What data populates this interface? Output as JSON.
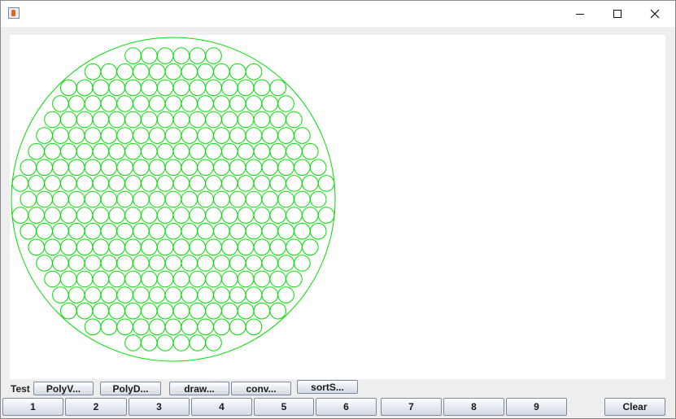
{
  "window": {
    "title": "",
    "icon": "java-cup-icon"
  },
  "window_controls": {
    "minimize": "minimize-icon",
    "maximize": "maximize-icon",
    "close": "close-icon"
  },
  "canvas": {
    "stroke_color": "#00dd00",
    "background": "#ffffff",
    "content": "circle-packed-in-circle"
  },
  "toolbar": {
    "label": "Test",
    "buttons": [
      "PolyV...",
      "PolyD...",
      "draw...",
      "conv...",
      "sortS..."
    ]
  },
  "number_row": {
    "buttons": [
      "1",
      "2",
      "3",
      "4",
      "5",
      "6",
      "7",
      "8",
      "9"
    ],
    "clear_label": "Clear"
  }
}
